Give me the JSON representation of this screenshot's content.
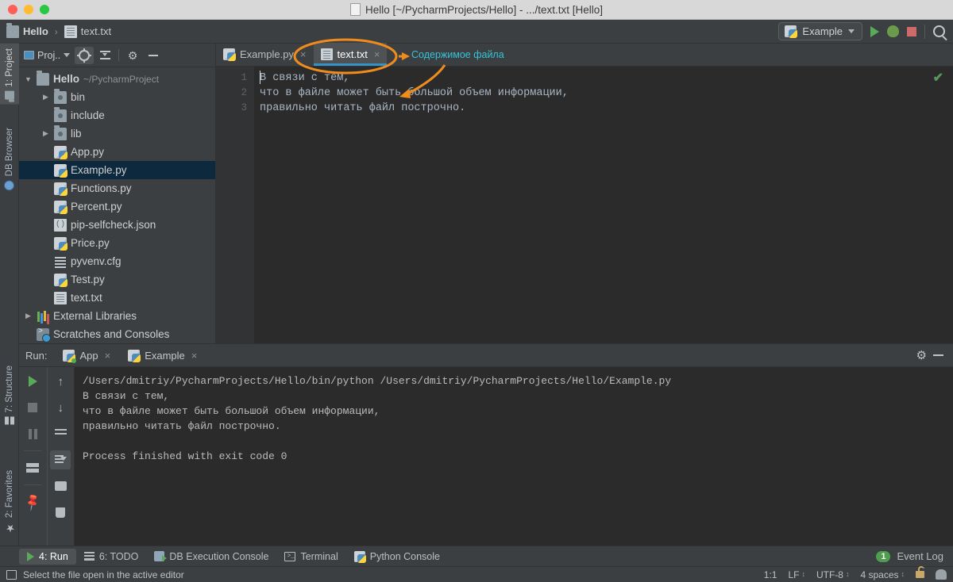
{
  "window": {
    "title": "Hello [~/PycharmProjects/Hello] - .../text.txt [Hello]",
    "title_icon": "file-icon"
  },
  "navbar": {
    "crumbs": [
      {
        "label": "Hello",
        "icon": "folder-icon"
      },
      {
        "label": "text.txt",
        "icon": "file-icon"
      }
    ],
    "separator": "›",
    "run_config": {
      "label": "Example",
      "icon": "python-icon",
      "caret": "▼"
    },
    "actions": [
      {
        "name": "run-button",
        "icon": "run-triangle-icon"
      },
      {
        "name": "debug-button",
        "icon": "bug-icon"
      },
      {
        "name": "stop-button",
        "icon": "stop-square-icon"
      },
      {
        "name": "search-everywhere-button",
        "icon": "search-icon"
      }
    ]
  },
  "left_tool_tabs": [
    {
      "label": "1: Project",
      "mnemonic": "1",
      "icon": "folder-icon",
      "active": true
    },
    {
      "label": "DB Browser",
      "icon": "db-browser-icon",
      "active": false
    }
  ],
  "left_tool_tabs_bottom": [
    {
      "label": "7: Structure",
      "mnemonic": "7",
      "icon": "structure-icon",
      "active": false
    },
    {
      "label": "2: Favorites",
      "mnemonic": "2",
      "icon": "star-icon",
      "active": false
    }
  ],
  "project_panel": {
    "title": "Proj..",
    "caret": "▼",
    "buttons": [
      {
        "name": "locate-target-button",
        "icon": "crosshair-icon",
        "active": true
      },
      {
        "name": "collapse-all-button",
        "icon": "collapse-all-icon",
        "active": false
      },
      {
        "name": "settings-button",
        "icon": "gear-icon",
        "active": false
      },
      {
        "name": "hide-button",
        "icon": "minus-icon",
        "active": false
      }
    ],
    "tree": [
      {
        "label": "Hello",
        "suffix": "~/PycharmProject",
        "icon": "folder-icon",
        "indent": 0,
        "arrow": "▼",
        "bold": true,
        "selected": false
      },
      {
        "label": "bin",
        "icon": "source-folder-icon",
        "indent": 1,
        "arrow": "▶",
        "bold": false,
        "selected": false
      },
      {
        "label": "include",
        "icon": "source-folder-icon",
        "indent": 1,
        "arrow": "",
        "bold": false,
        "selected": false
      },
      {
        "label": "lib",
        "icon": "source-folder-icon",
        "indent": 1,
        "arrow": "▶",
        "bold": false,
        "selected": false
      },
      {
        "label": "App.py",
        "icon": "python-file-icon",
        "indent": 1,
        "arrow": "",
        "bold": false,
        "selected": false
      },
      {
        "label": "Example.py",
        "icon": "python-file-icon",
        "indent": 1,
        "arrow": "",
        "bold": false,
        "selected": true
      },
      {
        "label": "Functions.py",
        "icon": "python-file-icon",
        "indent": 1,
        "arrow": "",
        "bold": false,
        "selected": false
      },
      {
        "label": "Percent.py",
        "icon": "python-file-icon",
        "indent": 1,
        "arrow": "",
        "bold": false,
        "selected": false
      },
      {
        "label": "pip-selfcheck.json",
        "icon": "json-file-icon",
        "indent": 1,
        "arrow": "",
        "bold": false,
        "selected": false
      },
      {
        "label": "Price.py",
        "icon": "python-file-icon",
        "indent": 1,
        "arrow": "",
        "bold": false,
        "selected": false
      },
      {
        "label": "pyvenv.cfg",
        "icon": "config-file-icon",
        "indent": 1,
        "arrow": "",
        "bold": false,
        "selected": false
      },
      {
        "label": "Test.py",
        "icon": "python-file-icon",
        "indent": 1,
        "arrow": "",
        "bold": false,
        "selected": false
      },
      {
        "label": "text.txt",
        "icon": "text-file-icon",
        "indent": 1,
        "arrow": "",
        "bold": false,
        "selected": false
      },
      {
        "label": "External Libraries",
        "icon": "libraries-icon",
        "indent": 0,
        "arrow": "▶",
        "bold": false,
        "selected": false
      },
      {
        "label": "Scratches and Consoles",
        "icon": "scratch-icon",
        "indent": 0,
        "arrow": "",
        "bold": false,
        "selected": false
      }
    ]
  },
  "editor": {
    "tabs": [
      {
        "label": "Example.py",
        "icon": "python-file-icon",
        "active": false,
        "close": "×"
      },
      {
        "label": "text.txt",
        "icon": "text-file-icon",
        "active": true,
        "close": "×"
      }
    ],
    "gutter_lines": [
      "1",
      "2",
      "3"
    ],
    "content_lines": [
      "В связи с тем,",
      "что в файле может быть большой объем информации,",
      "правильно читать файл построчно."
    ],
    "inspection_status": "✔"
  },
  "run_panel": {
    "label": "Run:",
    "tabs": [
      {
        "label": "App",
        "icon": "python-icon",
        "active": false,
        "running": true,
        "close": "×"
      },
      {
        "label": "Example",
        "icon": "python-icon",
        "active": true,
        "running": false,
        "close": "×"
      }
    ],
    "header_buttons": [
      {
        "name": "run-settings-button",
        "icon": "gear-icon"
      },
      {
        "name": "hide-run-panel-button",
        "icon": "minus-icon"
      }
    ],
    "tool_icons_left": [
      {
        "name": "rerun-button",
        "icon": "run-triangle-icon"
      },
      {
        "name": "stop-button",
        "icon": "stop-square-icon"
      },
      {
        "name": "pause-button",
        "icon": "pause-icon"
      },
      {
        "name": "layout-button",
        "icon": "layout-icon"
      },
      {
        "name": "pin-tab-button",
        "icon": "pin-icon"
      }
    ],
    "tool_icons_right": [
      {
        "name": "up-button",
        "icon": "arrow-up-icon"
      },
      {
        "name": "down-button",
        "icon": "arrow-down-icon"
      },
      {
        "name": "soft-wrap-button",
        "icon": "soft-wrap-icon"
      },
      {
        "name": "scroll-to-end-button",
        "icon": "scroll-to-end-icon"
      },
      {
        "name": "print-button",
        "icon": "printer-icon"
      },
      {
        "name": "clear-all-button",
        "icon": "trash-icon"
      }
    ],
    "console_lines": [
      "/Users/dmitriy/PycharmProjects/Hello/bin/python /Users/dmitriy/PycharmProjects/Hello/Example.py",
      "В связи с тем,",
      "что в файле может быть большой объем информации,",
      "правильно читать файл построчно.",
      "",
      "Process finished with exit code 0"
    ]
  },
  "tool_buttons": [
    {
      "label": "4: Run",
      "mnemonic": "4",
      "icon": "run-triangle-icon",
      "active": true
    },
    {
      "label": "6: TODO",
      "mnemonic": "6",
      "icon": "todo-list-icon",
      "active": false
    },
    {
      "label": "DB Execution Console",
      "icon": "db-console-icon",
      "active": false
    },
    {
      "label": "Terminal",
      "icon": "terminal-icon",
      "active": false
    },
    {
      "label": "Python Console",
      "icon": "python-icon",
      "active": false
    }
  ],
  "event_log": {
    "count": "1",
    "label": "Event Log"
  },
  "status_bar": {
    "message": "Select the file open in the active editor",
    "message_icon": "editor-select-icon",
    "caret_position": "1:1",
    "line_separator": "LF",
    "encoding": "UTF-8",
    "indent": "4 spaces",
    "lock_icon": "unlocked-padlock-icon",
    "inspector_icon": "detective-icon"
  },
  "annotations": [
    {
      "text": "Содержимое файла",
      "color": "#36c3d6",
      "highlight_color": "#f08c1e"
    }
  ],
  "colors": {
    "accent": "#3592c4",
    "annotation": "#f08c1e",
    "annotation_text": "#36c3d6",
    "selection": "#0d293e",
    "editor_bg": "#2b2b2b",
    "panel_bg": "#3c3f41"
  }
}
